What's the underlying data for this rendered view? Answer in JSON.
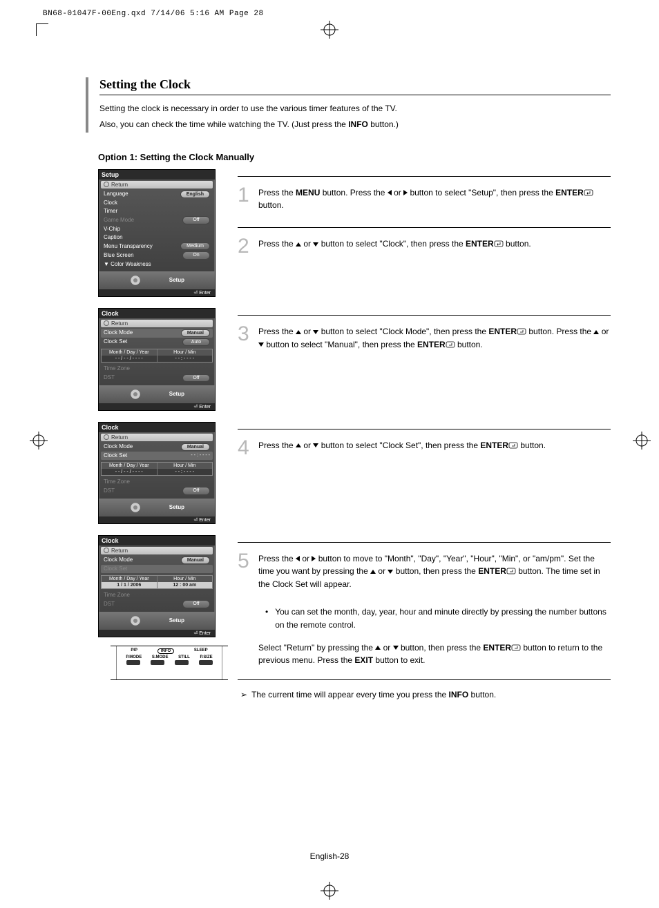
{
  "print_header": "BN68-01047F-00Eng.qxd  7/14/06  5:16 AM  Page 28",
  "title": "Setting the Clock",
  "intro_line1": "Setting the clock is necessary in order to use the various timer features of the TV.",
  "intro_line2_a": "Also, you can check the time while watching the TV. (Just press the ",
  "intro_line2_b": "INFO",
  "intro_line2_c": " button.)",
  "option_heading": "Option 1: Setting the Clock Manually",
  "steps": {
    "s1": {
      "num": "1",
      "a": "Press the ",
      "b": "MENU",
      "c": " button. Press the ",
      "d": " or ",
      "e": " button to select \"Setup\", then press the ",
      "f": "ENTER",
      "g": " button."
    },
    "s2": {
      "num": "2",
      "a": "Press the ",
      "b": " or ",
      "c": " button to select \"Clock\", then press the ",
      "d": "ENTER",
      "e": " button."
    },
    "s3": {
      "num": "3",
      "a": "Press the ",
      "b": " or ",
      "c": " button to select \"Clock Mode\", then press the ",
      "d": "ENTER",
      "e": " button. Press the ",
      "f": " or ",
      "g": " button to select \"Manual\", then press the ",
      "h": "ENTER",
      "i": " button."
    },
    "s4": {
      "num": "4",
      "a": "Press the ",
      "b": " or ",
      "c": " button to select \"Clock Set\", then press the ",
      "d": "ENTER",
      "e": " button."
    },
    "s5": {
      "num": "5",
      "a": "Press the ",
      "b": " or ",
      "c": " button to move to \"Month\", \"Day\", \"Year\", \"Hour\", \"Min\", or \"am/pm\". Set the time you want by pressing the ",
      "d": " or ",
      "e": " button, then press the ",
      "f": "ENTER",
      "g": " button. The time set in the Clock Set will appear."
    }
  },
  "note_bullet": "You can set the month, day, year, hour and minute directly by pressing the number buttons on the remote control.",
  "note_return_a": "Select \"Return\" by pressing the ",
  "note_return_b": " or ",
  "note_return_c": " button, then press the ",
  "note_return_d": "ENTER",
  "note_return_e": " button to return to the previous menu. Press the ",
  "note_return_f": "EXIT",
  "note_return_g": " button to exit.",
  "final_note_a": "The current time will appear every time you press the ",
  "final_note_b": "INFO",
  "final_note_c": " button.",
  "page_number": "English-28",
  "menu1": {
    "title": "Setup",
    "return": "Return",
    "rows": [
      {
        "label": "Language",
        "val": "English"
      },
      {
        "label": "Clock",
        "val": ""
      },
      {
        "label": "Timer",
        "val": ""
      },
      {
        "label": "Game Mode",
        "val": "Off"
      },
      {
        "label": "V-Chip",
        "val": ""
      },
      {
        "label": "Caption",
        "val": ""
      },
      {
        "label": "Menu Transparency",
        "val": "Medium"
      },
      {
        "label": "Blue Screen",
        "val": "On"
      },
      {
        "label": "▼ Color Weakness",
        "val": ""
      }
    ],
    "footer": "Setup",
    "enter": "Enter"
  },
  "menu2": {
    "title": "Clock",
    "return": "Return",
    "clock_mode_label": "Clock Mode",
    "clock_mode_val1": "Manual",
    "clock_mode_val2": "Auto",
    "clock_set_label": "Clock Set",
    "th_date": "Month / Day / Year",
    "th_time": "Hour / Min",
    "td_date": "- -  /  - -  /  - - - -",
    "td_time": "- -  :  - -   - -",
    "tz": "Time Zone",
    "dst": "DST",
    "dst_val": "Off",
    "footer": "Setup",
    "enter": "Enter"
  },
  "menu3": {
    "title": "Clock",
    "return": "Return",
    "clock_mode_label": "Clock Mode",
    "clock_mode_val": "Manual",
    "clock_set_label": "Clock Set",
    "clock_set_val": "- -  :  - -   - -",
    "th_date": "Month / Day / Year",
    "th_time": "Hour / Min",
    "td_date": "- -  /  - -  /  - - - -",
    "td_time": "- -  :  - -   - -",
    "tz": "Time Zone",
    "dst": "DST",
    "dst_val": "Off",
    "footer": "Setup",
    "enter": "Enter"
  },
  "menu4": {
    "title": "Clock",
    "return": "Return",
    "clock_mode_label": "Clock Mode",
    "clock_mode_val": "Manual",
    "clock_set_label": "Clock Set",
    "th_date": "Month / Day / Year",
    "th_time": "Hour / Min",
    "td_date": "1  /  1  /  2006",
    "td_time": "12  :  00   am",
    "tz": "Time Zone",
    "dst": "DST",
    "dst_val": "Off",
    "footer": "Setup",
    "enter": "Enter"
  },
  "remote": {
    "r1a": "PIP",
    "r1b": "INFO",
    "r1c": "SLEEP",
    "r2a": "P.MODE",
    "r2b": "S.MODE",
    "r2c": "STILL",
    "r2d": "P.SIZE"
  }
}
